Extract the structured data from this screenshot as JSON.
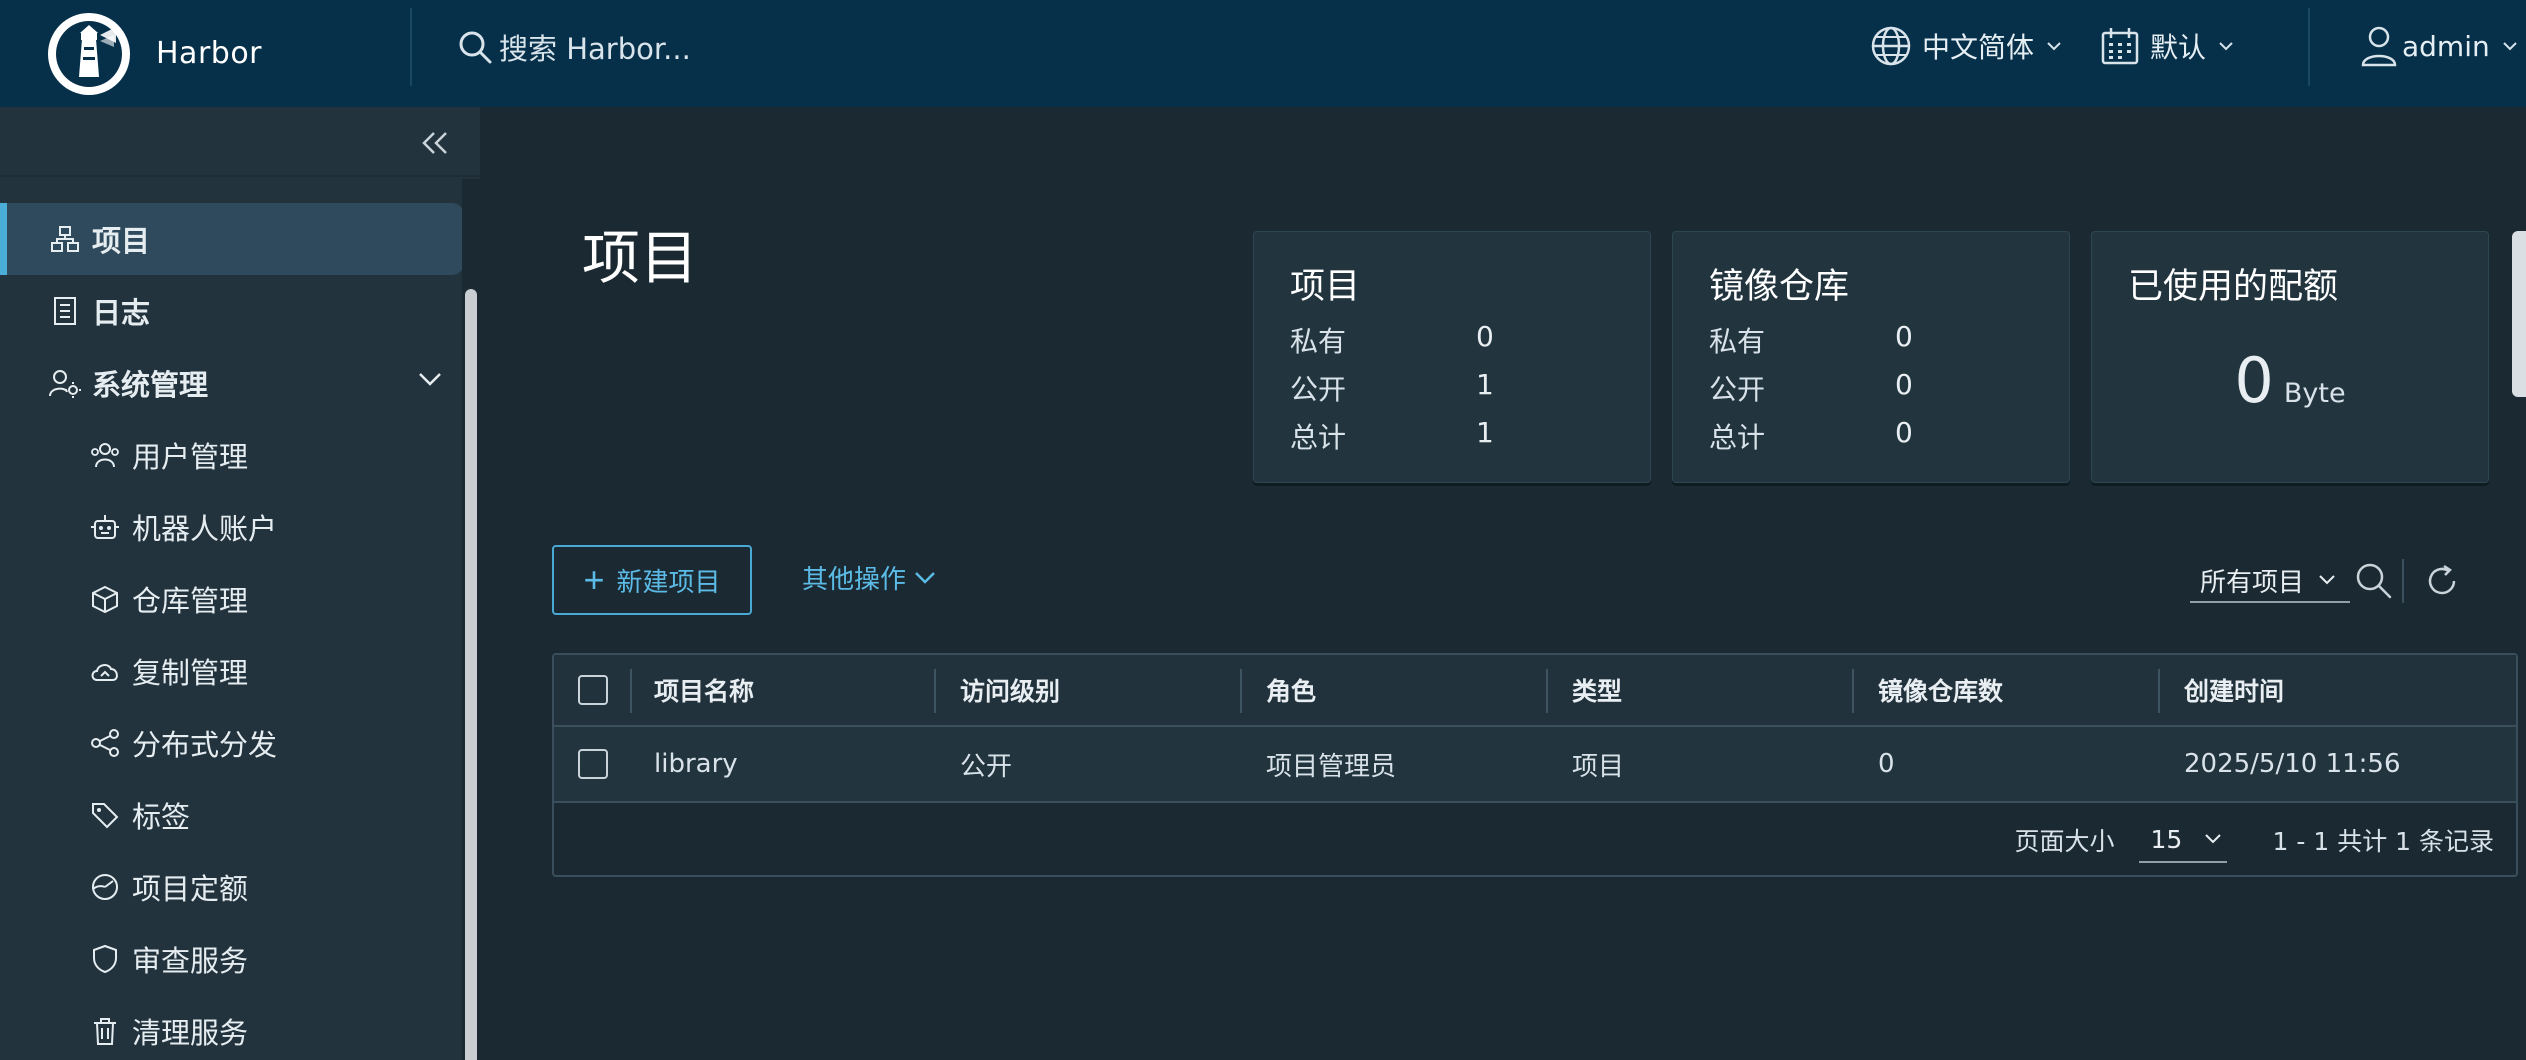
{
  "header": {
    "app_name": "Harbor",
    "search_placeholder": "搜索 Harbor...",
    "language": "中文简体",
    "date_format": "默认",
    "user": "admin"
  },
  "sidebar": {
    "items": [
      {
        "label": "项目",
        "icon": "projects-icon",
        "active": true
      },
      {
        "label": "日志",
        "icon": "logs-icon"
      },
      {
        "label": "系统管理",
        "icon": "admin-settings-icon",
        "expanded": true
      },
      {
        "label": "用户管理",
        "icon": "users-icon"
      },
      {
        "label": "机器人账户",
        "icon": "robot-icon"
      },
      {
        "label": "仓库管理",
        "icon": "cube-icon"
      },
      {
        "label": "复制管理",
        "icon": "cloud-sync-icon"
      },
      {
        "label": "分布式分发",
        "icon": "share-icon"
      },
      {
        "label": "标签",
        "icon": "tag-icon"
      },
      {
        "label": "项目定额",
        "icon": "quota-gauge-icon"
      },
      {
        "label": "审查服务",
        "icon": "shield-icon"
      },
      {
        "label": "清理服务",
        "icon": "trash-icon"
      }
    ]
  },
  "main": {
    "title": "项目",
    "summary": {
      "projects": {
        "title": "项目",
        "private_label": "私有",
        "private": "0",
        "public_label": "公开",
        "public": "1",
        "total_label": "总计",
        "total": "1"
      },
      "repos": {
        "title": "镜像仓库",
        "private_label": "私有",
        "private": "0",
        "public_label": "公开",
        "public": "0",
        "total_label": "总计",
        "total": "0"
      },
      "quota": {
        "title": "已使用的配额",
        "value": "0",
        "unit": "Byte"
      }
    },
    "toolbar": {
      "new_project": "新建项目",
      "more_actions": "其他操作",
      "filter": "所有项目"
    },
    "table": {
      "columns": [
        "项目名称",
        "访问级别",
        "角色",
        "类型",
        "镜像仓库数",
        "创建时间"
      ],
      "rows": [
        {
          "name": "library",
          "access": "公开",
          "role": "项目管理员",
          "type": "项目",
          "repo_count": "0",
          "created": "2025/5/10 11:56"
        }
      ],
      "page_size_label": "页面大小",
      "page_size": "15",
      "summary": "1 - 1 共计 1 条记录"
    }
  },
  "colors": {
    "header_bg": "#06304a",
    "sidebar_bg": "#22333d",
    "main_bg": "#1b2a32",
    "accent": "#5cbbe6",
    "active_item_bg": "#2f4a5c"
  }
}
